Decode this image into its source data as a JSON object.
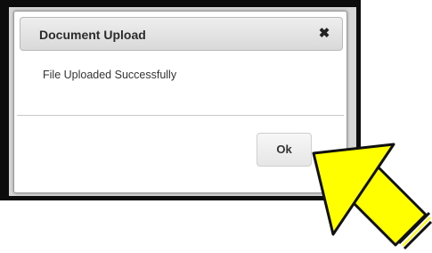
{
  "dialog": {
    "title": "Document Upload",
    "close_label": "✖",
    "message": "File Uploaded Successfully",
    "ok_label": "Ok"
  },
  "annotation": {
    "arrow_color": "#ffff00"
  }
}
